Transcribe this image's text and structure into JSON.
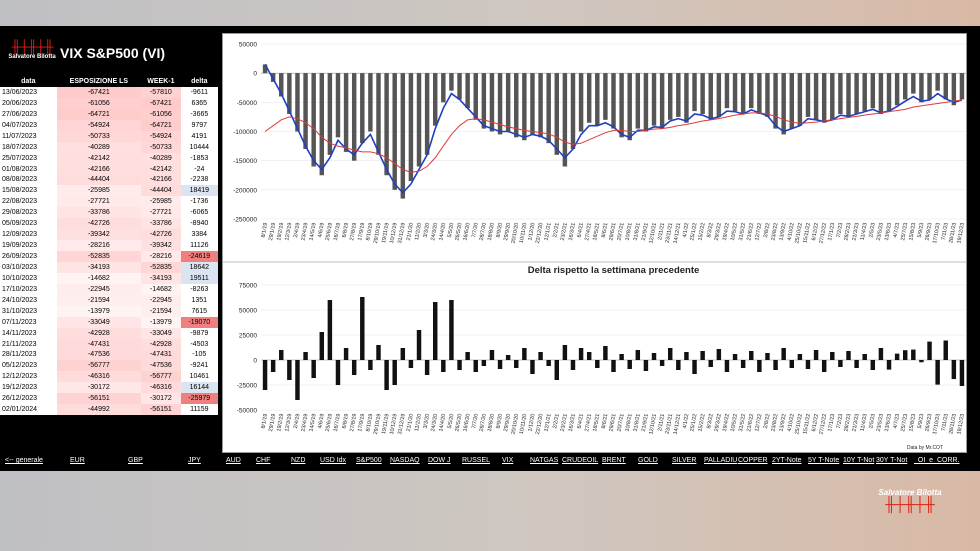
{
  "brand": {
    "name": "Salvatore Bilotta",
    "wave": "╫┼╫┼╫"
  },
  "left_panel": {
    "title": "VIX S&P500 (VI)",
    "columns": [
      "data",
      "ESPOSIZIONE LS",
      "WEEK-1",
      "delta"
    ],
    "rows": [
      [
        "13/06/2023",
        "-67421",
        "-57810",
        "-9611"
      ],
      [
        "20/06/2023",
        "-61056",
        "-67421",
        "6365"
      ],
      [
        "27/06/2023",
        "-64721",
        "-61056",
        "-3665"
      ],
      [
        "04/07/2023",
        "-54924",
        "-64721",
        "9797"
      ],
      [
        "11/07/2023",
        "-50733",
        "-54924",
        "4191"
      ],
      [
        "18/07/2023",
        "-40289",
        "-50733",
        "10444"
      ],
      [
        "25/07/2023",
        "-42142",
        "-40289",
        "-1853"
      ],
      [
        "01/08/2023",
        "-42166",
        "-42142",
        "-24"
      ],
      [
        "08/08/2023",
        "-44404",
        "-42166",
        "-2238"
      ],
      [
        "15/08/2023",
        "-25985",
        "-44404",
        "18419"
      ],
      [
        "22/08/2023",
        "-27721",
        "-25985",
        "-1736"
      ],
      [
        "29/08/2023",
        "-33786",
        "-27721",
        "-6065"
      ],
      [
        "05/09/2023",
        "-42726",
        "-33786",
        "-8940"
      ],
      [
        "12/09/2023",
        "-39342",
        "-42726",
        "3384"
      ],
      [
        "19/09/2023",
        "-28216",
        "-39342",
        "11126"
      ],
      [
        "26/09/2023",
        "-52835",
        "-28216",
        "-24619"
      ],
      [
        "03/10/2023",
        "-34193",
        "-52835",
        "18642"
      ],
      [
        "10/10/2023",
        "-14682",
        "-34193",
        "19511"
      ],
      [
        "17/10/2023",
        "-22945",
        "-14682",
        "-8263"
      ],
      [
        "24/10/2023",
        "-21594",
        "-22945",
        "1351"
      ],
      [
        "31/10/2023",
        "-13979",
        "-21594",
        "7615"
      ],
      [
        "07/11/2023",
        "-33049",
        "-13979",
        "-19070"
      ],
      [
        "14/11/2023",
        "-42928",
        "-33049",
        "-9879"
      ],
      [
        "21/11/2023",
        "-47431",
        "-42928",
        "-4503"
      ],
      [
        "28/11/2023",
        "-47536",
        "-47431",
        "-105"
      ],
      [
        "05/12/2023",
        "-56777",
        "-47536",
        "-9241"
      ],
      [
        "12/12/2023",
        "-46316",
        "-56777",
        "10461"
      ],
      [
        "19/12/2023",
        "-30172",
        "-46316",
        "16144"
      ],
      [
        "26/12/2023",
        "-56151",
        "-30172",
        "-25979"
      ],
      [
        "02/01/2024",
        "-44992",
        "-56151",
        "11159"
      ]
    ]
  },
  "nav": [
    "<-- generale",
    "EUR",
    "GBP",
    "JPY",
    "AUD",
    "CHF",
    "NZD",
    "USD Idx",
    "S&P500",
    "NASDAQ",
    "DOW J",
    "RUSSEL",
    "VIX",
    "NATGAS",
    "CRUDEOIL",
    "BRENT",
    "GOLD",
    "SILVER",
    "PALLADIU",
    "COPPER",
    "2YT-Note",
    "5Y T-Note",
    "10Y T-Not",
    "30Y T-Not",
    "_OI_e_CORR."
  ],
  "chart_credit": "Data by Mr.COT",
  "colors": {
    "bars": "#555555",
    "blue_line": "#1f3fbf",
    "red_line": "#e03a3a",
    "pos_delta": "#dbe5f1",
    "neg_delta": "#f08080"
  },
  "chart_data": [
    {
      "type": "bar",
      "title": "",
      "ylim": [
        -250000,
        50000
      ],
      "yticks": [
        "50000",
        "0",
        "-50000",
        "-100000",
        "-150000",
        "-200000",
        "-250000"
      ],
      "ytick_values": [
        50000,
        0,
        -50000,
        -100000,
        -150000,
        -200000,
        -250000
      ],
      "xticks": [
        "8/1/19",
        "29/1/19",
        "19/2/19",
        "12/3/19",
        "2/4/19",
        "23/4/19",
        "14/5/19",
        "4/6/19",
        "25/6/19",
        "16/7/19",
        "6/8/19",
        "27/8/19",
        "17/9/19",
        "8/10/19",
        "29/10/19",
        "19/11/19",
        "10/12/19",
        "31/12/19",
        "21/1/20",
        "11/2/20",
        "3/3/20",
        "24/3/20",
        "14/4/20",
        "5/5/20",
        "26/5/20",
        "16/6/20",
        "7/7/20",
        "28/7/20",
        "18/8/20",
        "8/9/20",
        "29/9/20",
        "20/10/20",
        "10/11/20",
        "1/12/20",
        "22/12/20",
        "12/1/21",
        "2/2/21",
        "23/2/21",
        "16/3/21",
        "6/4/21",
        "27/4/21",
        "18/5/21",
        "8/6/21",
        "29/6/21",
        "20/7/21",
        "10/8/21",
        "31/8/21",
        "21/9/21",
        "12/10/21",
        "2/11/21",
        "23/11/21",
        "14/12/21",
        "4/1/22",
        "25/1/22",
        "15/2/22",
        "8/3/22",
        "29/3/22",
        "19/4/22",
        "10/5/22",
        "31/5/22",
        "21/6/22",
        "12/7/22",
        "2/8/22",
        "23/8/22",
        "13/9/22",
        "4/10/22",
        "25/10/22",
        "15/11/22",
        "6/12/22",
        "27/12/22",
        "17/1/23",
        "7/2/23",
        "28/2/23",
        "21/3/23",
        "11/4/23",
        "2/5/23",
        "23/5/23",
        "13/6/23",
        "4/7/23",
        "25/7/23",
        "15/8/23",
        "5/9/23",
        "26/9/23",
        "17/10/23",
        "7/11/23",
        "28/11/23",
        "19/12/23"
      ],
      "series": [
        {
          "name": "",
          "kind": "bar",
          "values": [
            15000,
            -15000,
            -40000,
            -70000,
            -100000,
            -130000,
            -160000,
            -175000,
            -140000,
            -110000,
            -135000,
            -150000,
            -120000,
            -100000,
            -140000,
            -175000,
            -200000,
            -215000,
            -185000,
            -160000,
            -140000,
            -90000,
            -50000,
            -30000,
            -45000,
            -60000,
            -80000,
            -95000,
            -100000,
            -105000,
            -100000,
            -110000,
            -115000,
            -105000,
            -110000,
            -120000,
            -140000,
            -160000,
            -130000,
            -100000,
            -85000,
            -90000,
            -80000,
            -95000,
            -110000,
            -115000,
            -95000,
            -100000,
            -90000,
            -95000,
            -80000,
            -75000,
            -85000,
            -65000,
            -70000,
            -80000,
            -75000,
            -60000,
            -65000,
            -70000,
            -60000,
            -70000,
            -75000,
            -95000,
            -105000,
            -95000,
            -90000,
            -75000,
            -80000,
            -85000,
            -80000,
            -70000,
            -75000,
            -70000,
            -65000,
            -60000,
            -70000,
            -65000,
            -55000,
            -45000,
            -35000,
            -50000,
            -45000,
            -30000,
            -45000,
            -55000,
            -45000
          ]
        },
        {
          "name": "",
          "kind": "line",
          "values": [
            15000,
            -10000,
            -35000,
            -65000,
            -95000,
            -125000,
            -150000,
            -165000,
            -145000,
            -115000,
            -130000,
            -140000,
            -120000,
            -105000,
            -135000,
            -165000,
            -190000,
            -205000,
            -190000,
            -165000,
            -140000,
            -95000,
            -60000,
            -35000,
            -45000,
            -60000,
            -75000,
            -90000,
            -95000,
            -100000,
            -100000,
            -105000,
            -110000,
            -105000,
            -108000,
            -115000,
            -130000,
            -145000,
            -130000,
            -105000,
            -90000,
            -90000,
            -85000,
            -92000,
            -105000,
            -110000,
            -98000,
            -98000,
            -92000,
            -93000,
            -82000,
            -78000,
            -82000,
            -70000,
            -72000,
            -78000,
            -75000,
            -65000,
            -66000,
            -70000,
            -63000,
            -68000,
            -73000,
            -90000,
            -100000,
            -95000,
            -90000,
            -78000,
            -80000,
            -83000,
            -80000,
            -72000,
            -74000,
            -70000,
            -66000,
            -62000,
            -68000,
            -65000,
            -57000,
            -48000,
            -40000,
            -48000,
            -46000,
            -35000,
            -44000,
            -50000,
            -46000
          ]
        },
        {
          "name": "",
          "kind": "line",
          "values": [
            -100000,
            -90000,
            -80000,
            -75000,
            -78000,
            -85000,
            -95000,
            -110000,
            -120000,
            -125000,
            -128000,
            -132000,
            -135000,
            -135000,
            -138000,
            -145000,
            -155000,
            -165000,
            -170000,
            -168000,
            -160000,
            -145000,
            -125000,
            -105000,
            -90000,
            -80000,
            -78000,
            -80000,
            -84000,
            -88000,
            -92000,
            -95000,
            -98000,
            -100000,
            -102000,
            -104000,
            -110000,
            -118000,
            -122000,
            -120000,
            -114000,
            -108000,
            -102000,
            -98000,
            -98000,
            -100000,
            -100000,
            -98000,
            -96000,
            -95000,
            -93000,
            -90000,
            -88000,
            -85000,
            -82000,
            -80000,
            -78000,
            -75000,
            -72000,
            -70000,
            -68000,
            -68000,
            -70000,
            -74000,
            -80000,
            -84000,
            -86000,
            -85000,
            -84000,
            -82000,
            -80000,
            -78000,
            -76000,
            -74000,
            -72000,
            -70000,
            -68000,
            -66000,
            -64000,
            -62000,
            -58000,
            -56000,
            -54000,
            -52000,
            -50000,
            -48000,
            -46000
          ]
        }
      ]
    },
    {
      "type": "bar",
      "title": "Delta rispetto la settimana precedente",
      "ylim": [
        -50000,
        75000
      ],
      "yticks": [
        "75000",
        "50000",
        "25000",
        "0",
        "-25000",
        "-50000"
      ],
      "ytick_values": [
        75000,
        50000,
        25000,
        0,
        -25000,
        -50000
      ],
      "xticks": [
        "8/1/19",
        "29/1/19",
        "19/2/19",
        "12/3/19",
        "2/4/19",
        "23/4/19",
        "14/5/19",
        "4/6/19",
        "25/6/19",
        "16/7/19",
        "6/8/19",
        "27/8/19",
        "17/9/19",
        "8/10/19",
        "29/10/19",
        "19/11/19",
        "10/12/19",
        "31/12/19",
        "21/1/20",
        "11/2/20",
        "3/3/20",
        "24/3/20",
        "14/4/20",
        "5/5/20",
        "26/5/20",
        "16/6/20",
        "7/7/20",
        "28/7/20",
        "18/8/20",
        "8/9/20",
        "29/9/20",
        "20/10/20",
        "10/11/20",
        "1/12/20",
        "22/12/20",
        "12/1/21",
        "2/2/21",
        "23/2/21",
        "16/3/21",
        "6/4/21",
        "27/4/21",
        "18/5/21",
        "8/6/21",
        "29/6/21",
        "20/7/21",
        "10/8/21",
        "31/8/21",
        "21/9/21",
        "12/10/21",
        "2/11/21",
        "23/11/21",
        "14/12/21",
        "4/1/22",
        "25/1/22",
        "15/2/22",
        "8/3/22",
        "29/3/22",
        "19/4/22",
        "10/5/22",
        "31/5/22",
        "21/6/22",
        "12/7/22",
        "2/8/22",
        "23/8/22",
        "13/9/22",
        "4/10/22",
        "25/10/22",
        "15/11/22",
        "6/12/22",
        "27/12/22",
        "17/1/23",
        "7/2/23",
        "28/2/23",
        "21/3/23",
        "11/4/23",
        "2/5/23",
        "23/5/23",
        "13/6/23",
        "4/7/23",
        "25/7/23",
        "15/8/23",
        "5/9/23",
        "26/9/23",
        "17/10/23",
        "7/11/23",
        "28/11/23",
        "19/12/23"
      ],
      "series": [
        {
          "name": "",
          "values": [
            -30000,
            -12000,
            10000,
            -20000,
            -40000,
            8000,
            -18000,
            28000,
            60000,
            -25000,
            12000,
            -15000,
            63000,
            -10000,
            15000,
            -30000,
            -25000,
            12000,
            -8000,
            30000,
            -15000,
            58000,
            -12000,
            60000,
            -10000,
            8000,
            -12000,
            -6000,
            10000,
            -9000,
            5000,
            -8000,
            12000,
            -14000,
            8000,
            -6000,
            -20000,
            15000,
            -10000,
            12000,
            8000,
            -8000,
            14000,
            -12000,
            6000,
            -9000,
            10000,
            -11000,
            7000,
            -6000,
            12000,
            -10000,
            8000,
            -14000,
            9000,
            -7000,
            11000,
            -12000,
            6000,
            -8000,
            9000,
            -12000,
            7000,
            -10000,
            12000,
            -8000,
            6000,
            -9000,
            10000,
            -12000,
            8000,
            -7000,
            9000,
            -8000,
            6000,
            -10000,
            12000,
            -9611,
            6365,
            9797,
            10444,
            -2238,
            18419,
            -24619,
            19511,
            -19070,
            -25979
          ]
        }
      ]
    }
  ]
}
